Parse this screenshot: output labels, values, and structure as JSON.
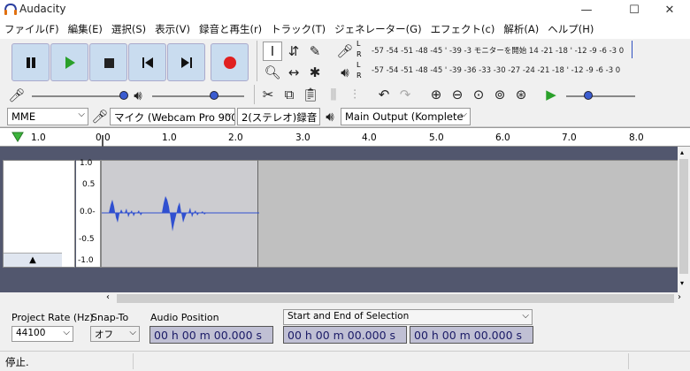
{
  "window": {
    "title": "Audacity",
    "min": "—",
    "max": "☐",
    "close": "✕"
  },
  "menu": [
    "ファイル(F)",
    "編集(E)",
    "選択(S)",
    "表示(V)",
    "録音と再生(r)",
    "トラック(T)",
    "ジェネレーター(G)",
    "エフェクト(c)",
    "解析(A)",
    "ヘルプ(H)"
  ],
  "meters": {
    "record_scale": "-57 -54 -51 -48 -45   '  -39 -3 モニターを開始 14 -21 -18  '  -12 -9   -6  -3  0",
    "play_scale": "-57 -54 -51 -48 -45   '  -39 -36 -33 -30 -27 -24 -21 -18  '  -12 -9   -6  -3  0",
    "L": "L",
    "R": "R"
  },
  "device": {
    "host": "MME",
    "mic": "マイク (Webcam Pro 900",
    "channels": "2(ステレオ)録音",
    "output": "Main Output (Komplete"
  },
  "ruler": {
    "ticks": [
      "1.0",
      "0.0",
      "1.0",
      "2.0",
      "3.0",
      "4.0",
      "5.0",
      "6.0",
      "7.0",
      "8.0"
    ]
  },
  "track": {
    "scale": [
      "1.0",
      "0.5",
      "0.0-",
      "-0.5",
      "-1.0"
    ],
    "collapse": "▲"
  },
  "selection": {
    "project_rate_label": "Project Rate (Hz)",
    "project_rate": "44100",
    "snap_label": "Snap-To",
    "snap_value": "オフ",
    "audio_position_label": "Audio Position",
    "audio_position": "00 h 00 m 00.000 s",
    "range_label": "Start and End of Selection",
    "start": "00 h 00 m 00.000 s",
    "end": "00 h 00 m 00.000 s"
  },
  "status": "停止."
}
